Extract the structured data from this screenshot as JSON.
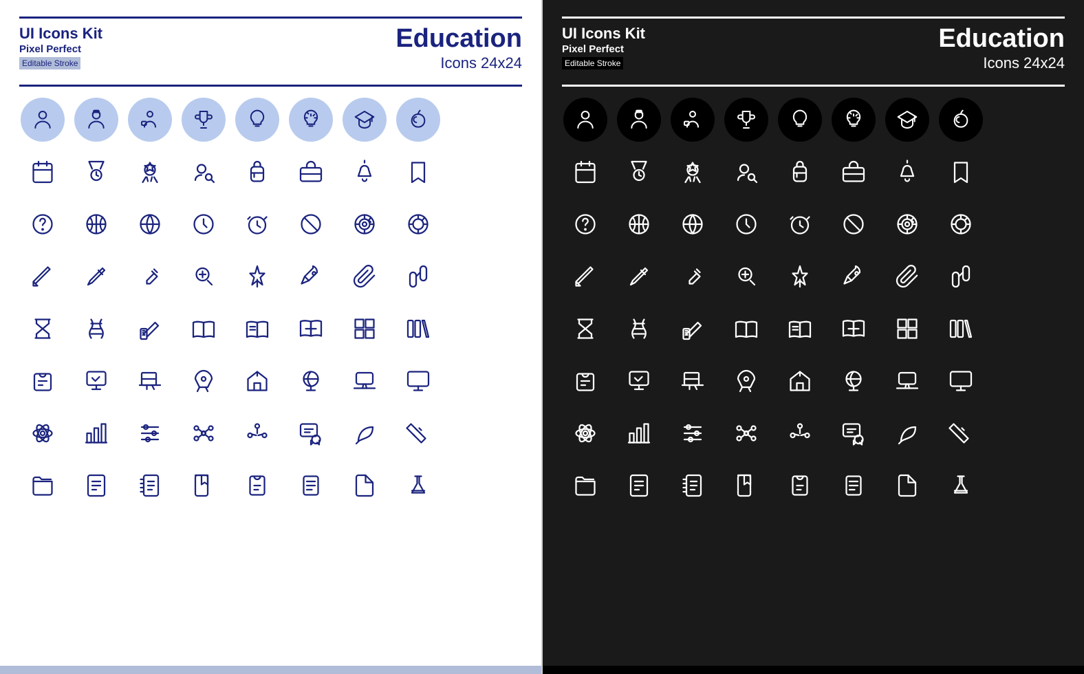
{
  "light": {
    "kit_title": "UI Icons Kit",
    "pixel_perfect": "Pixel Perfect",
    "editable_stroke": "Editable Stroke",
    "education_title": "Education",
    "icons_size": "Icons 24x24",
    "theme": "light"
  },
  "dark": {
    "kit_title": "UI Icons Kit",
    "pixel_perfect": "Pixel Perfect",
    "editable_stroke": "Editable Stroke",
    "education_title": "Education",
    "icons_size": "Icons 24x24",
    "theme": "dark"
  }
}
